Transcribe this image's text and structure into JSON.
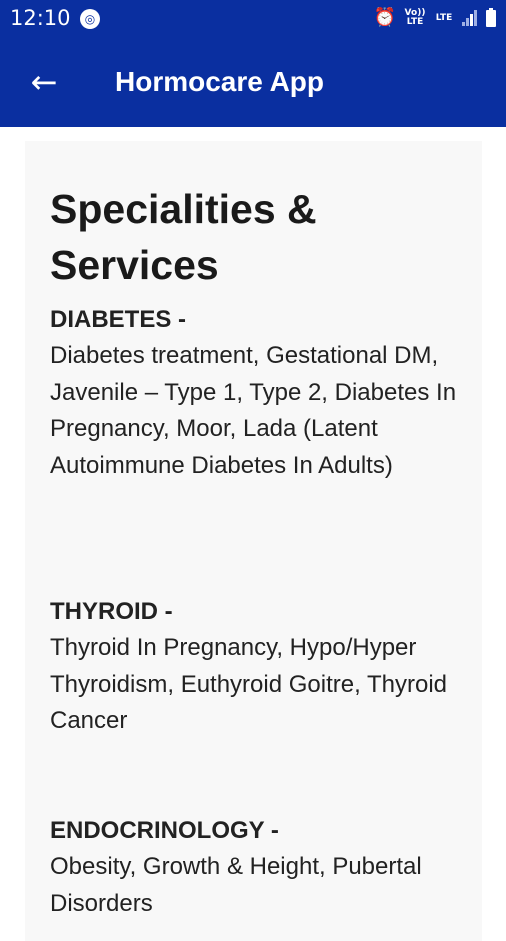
{
  "status_bar": {
    "time": "12:10",
    "right_icons": [
      "alarm-icon",
      "volte-icon",
      "lte-icon",
      "signal-icon",
      "battery-icon"
    ],
    "volte_text": "Vo)) LTE",
    "lte_text": "LTE"
  },
  "app_bar": {
    "title": "Hormocare App"
  },
  "content": {
    "heading": "Specialities & Services",
    "sections": [
      {
        "title": "DIABETES -",
        "body": "Diabetes treatment, Gestational DM, Javenile – Type 1, Type 2, Diabetes In Pregnancy, Moor, Lada (Latent Autoimmune Diabetes In Adults)"
      },
      {
        "title": "THYROID -",
        "body": "Thyroid In Pregnancy, Hypo/Hyper Thyroidism, Euthyroid Goitre, Thyroid Cancer"
      },
      {
        "title": "ENDOCRINOLOGY -",
        "body": "Obesity, Growth & Height, Pubertal Disorders"
      }
    ]
  },
  "colors": {
    "primary": "#0a2fa0",
    "card": "#f8f8f8",
    "text": "#222222"
  }
}
